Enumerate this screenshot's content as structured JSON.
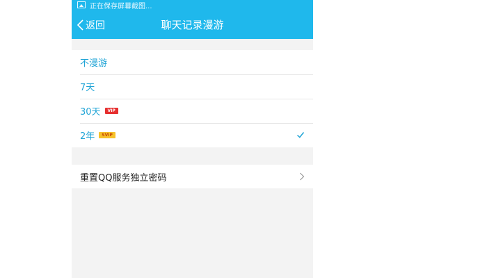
{
  "status_bar": {
    "icon": "image-icon",
    "text": "正在保存屏幕截图..."
  },
  "header": {
    "back_label": "返回",
    "title": "聊天记录漫游",
    "bg_color": "#1fb8ec"
  },
  "roaming_options": [
    {
      "label": "不漫游",
      "badge": "",
      "selected": false
    },
    {
      "label": "7天",
      "badge": "",
      "selected": false
    },
    {
      "label": "30天",
      "badge": "VIP",
      "selected": false
    },
    {
      "label": "2年",
      "badge": "SVIP",
      "selected": true
    }
  ],
  "reset_item": {
    "label": "重置QQ服务独立密码",
    "icon": "chevron-right-icon"
  },
  "colors": {
    "accent": "#20a4d6",
    "vip_badge": "#e62f2f",
    "svip_badge": "#f6c12a"
  }
}
